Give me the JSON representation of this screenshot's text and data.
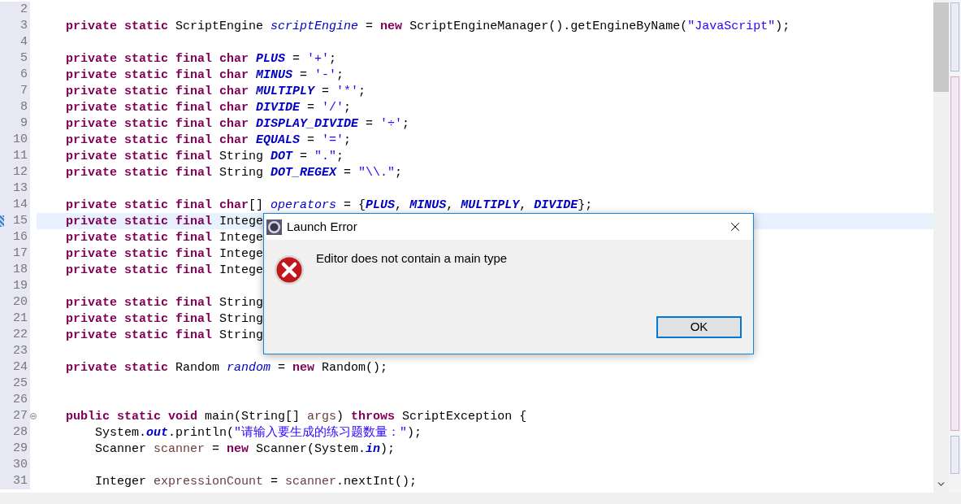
{
  "editor": {
    "lines": [
      {
        "number": "2",
        "selected": false,
        "fold": false
      },
      {
        "number": "3",
        "selected": false,
        "fold": false,
        "kind": "member",
        "tokens": [
          {
            "kind": "kw",
            "text": "private static"
          },
          {
            "kind": "plain",
            "text": " ScriptEngine "
          },
          {
            "kind": "field",
            "text": "scriptEngine"
          },
          {
            "kind": "plain",
            "text": " = "
          },
          {
            "kind": "kw",
            "text": "new"
          },
          {
            "kind": "plain",
            "text": " ScriptEngineManager().getEngineByName("
          },
          {
            "kind": "str",
            "text": "\"JavaScript\""
          },
          {
            "kind": "plain",
            "text": ");"
          }
        ]
      },
      {
        "number": "4",
        "selected": false,
        "fold": false
      },
      {
        "number": "5",
        "selected": false,
        "fold": false,
        "kind": "member",
        "tokens": [
          {
            "kind": "kw",
            "text": "private static final char"
          },
          {
            "kind": "const",
            "text": " PLUS"
          },
          {
            "kind": "plain",
            "text": " = "
          },
          {
            "kind": "str",
            "text": "'+'"
          },
          {
            "kind": "plain",
            "text": ";"
          }
        ]
      },
      {
        "number": "6",
        "selected": false,
        "fold": false,
        "kind": "member",
        "tokens": [
          {
            "kind": "kw",
            "text": "private static final char"
          },
          {
            "kind": "const",
            "text": " MINUS"
          },
          {
            "kind": "plain",
            "text": " = "
          },
          {
            "kind": "str",
            "text": "'-'"
          },
          {
            "kind": "plain",
            "text": ";"
          }
        ]
      },
      {
        "number": "7",
        "selected": false,
        "fold": false,
        "kind": "member",
        "tokens": [
          {
            "kind": "kw",
            "text": "private static final char"
          },
          {
            "kind": "const",
            "text": " MULTIPLY"
          },
          {
            "kind": "plain",
            "text": " = "
          },
          {
            "kind": "str",
            "text": "'*'"
          },
          {
            "kind": "plain",
            "text": ";"
          }
        ]
      },
      {
        "number": "8",
        "selected": false,
        "fold": false,
        "kind": "member",
        "tokens": [
          {
            "kind": "kw",
            "text": "private static final char"
          },
          {
            "kind": "const",
            "text": " DIVIDE"
          },
          {
            "kind": "plain",
            "text": " = "
          },
          {
            "kind": "str",
            "text": "'/'"
          },
          {
            "kind": "plain",
            "text": ";"
          }
        ]
      },
      {
        "number": "9",
        "selected": false,
        "fold": false,
        "kind": "member",
        "tokens": [
          {
            "kind": "kw",
            "text": "private static final char"
          },
          {
            "kind": "const",
            "text": " DISPLAY_DIVIDE"
          },
          {
            "kind": "plain",
            "text": " = "
          },
          {
            "kind": "str",
            "text": "'÷'"
          },
          {
            "kind": "plain",
            "text": ";"
          }
        ]
      },
      {
        "number": "10",
        "selected": false,
        "fold": false,
        "kind": "member",
        "tokens": [
          {
            "kind": "kw",
            "text": "private static final char"
          },
          {
            "kind": "const",
            "text": " EQUALS"
          },
          {
            "kind": "plain",
            "text": " = "
          },
          {
            "kind": "str",
            "text": "'='"
          },
          {
            "kind": "plain",
            "text": ";"
          }
        ]
      },
      {
        "number": "11",
        "selected": false,
        "fold": false,
        "kind": "member",
        "tokens": [
          {
            "kind": "kw",
            "text": "private static final"
          },
          {
            "kind": "plain",
            "text": " String "
          },
          {
            "kind": "const",
            "text": "DOT"
          },
          {
            "kind": "plain",
            "text": " = "
          },
          {
            "kind": "str",
            "text": "\".\""
          },
          {
            "kind": "plain",
            "text": ";"
          }
        ]
      },
      {
        "number": "12",
        "selected": false,
        "fold": false,
        "kind": "member",
        "tokens": [
          {
            "kind": "kw",
            "text": "private static final"
          },
          {
            "kind": "plain",
            "text": " String "
          },
          {
            "kind": "const",
            "text": "DOT_REGEX"
          },
          {
            "kind": "plain",
            "text": " = "
          },
          {
            "kind": "str",
            "text": "\"\\\\.\""
          },
          {
            "kind": "plain",
            "text": ";"
          }
        ]
      },
      {
        "number": "13",
        "selected": false,
        "fold": false
      },
      {
        "number": "14",
        "selected": false,
        "fold": false,
        "kind": "member",
        "tokens": [
          {
            "kind": "kw",
            "text": "private static final char"
          },
          {
            "kind": "plain",
            "text": "[] "
          },
          {
            "kind": "field",
            "text": "operators"
          },
          {
            "kind": "plain",
            "text": " = {"
          },
          {
            "kind": "const",
            "text": "PLUS"
          },
          {
            "kind": "plain",
            "text": ", "
          },
          {
            "kind": "const",
            "text": "MINUS"
          },
          {
            "kind": "plain",
            "text": ", "
          },
          {
            "kind": "const",
            "text": "MULTIPLY"
          },
          {
            "kind": "plain",
            "text": ", "
          },
          {
            "kind": "const",
            "text": "DIVIDE"
          },
          {
            "kind": "plain",
            "text": "};"
          }
        ]
      },
      {
        "number": "15",
        "selected": true,
        "fold": false,
        "kind": "member",
        "tokens": [
          {
            "kind": "kw",
            "text": "private static final"
          },
          {
            "kind": "plain",
            "text": " Intege"
          }
        ]
      },
      {
        "number": "16",
        "selected": false,
        "fold": false,
        "kind": "member",
        "tokens": [
          {
            "kind": "kw",
            "text": "private static final"
          },
          {
            "kind": "plain",
            "text": " Intege"
          }
        ]
      },
      {
        "number": "17",
        "selected": false,
        "fold": false,
        "kind": "member",
        "tokens": [
          {
            "kind": "kw",
            "text": "private static final"
          },
          {
            "kind": "plain",
            "text": " Intege"
          }
        ]
      },
      {
        "number": "18",
        "selected": false,
        "fold": false,
        "kind": "member",
        "tokens": [
          {
            "kind": "kw",
            "text": "private static final"
          },
          {
            "kind": "plain",
            "text": " Intege"
          }
        ]
      },
      {
        "number": "19",
        "selected": false,
        "fold": false
      },
      {
        "number": "20",
        "selected": false,
        "fold": false,
        "kind": "member",
        "tokens": [
          {
            "kind": "kw",
            "text": "private static final"
          },
          {
            "kind": "plain",
            "text": " String"
          }
        ]
      },
      {
        "number": "21",
        "selected": false,
        "fold": false,
        "kind": "member",
        "tokens": [
          {
            "kind": "kw",
            "text": "private static final"
          },
          {
            "kind": "plain",
            "text": " String"
          }
        ]
      },
      {
        "number": "22",
        "selected": false,
        "fold": false,
        "kind": "member",
        "tokens": [
          {
            "kind": "kw",
            "text": "private static final"
          },
          {
            "kind": "plain",
            "text": " String"
          }
        ]
      },
      {
        "number": "23",
        "selected": false,
        "fold": false
      },
      {
        "number": "24",
        "selected": false,
        "fold": false,
        "kind": "member",
        "tokens": [
          {
            "kind": "kw",
            "text": "private static"
          },
          {
            "kind": "plain",
            "text": " Random "
          },
          {
            "kind": "field",
            "text": "random"
          },
          {
            "kind": "plain",
            "text": " = "
          },
          {
            "kind": "kw",
            "text": "new"
          },
          {
            "kind": "plain",
            "text": " Random();"
          }
        ]
      },
      {
        "number": "25",
        "selected": false,
        "fold": false
      },
      {
        "number": "26",
        "selected": false,
        "fold": false
      },
      {
        "number": "27",
        "selected": false,
        "fold": true,
        "kind": "member",
        "tokens": [
          {
            "kind": "kw",
            "text": "public static void"
          },
          {
            "kind": "plain",
            "text": " main(String[] "
          },
          {
            "kind": "local",
            "text": "args"
          },
          {
            "kind": "plain",
            "text": ") "
          },
          {
            "kind": "kw",
            "text": "throws"
          },
          {
            "kind": "plain",
            "text": " ScriptException {"
          }
        ]
      },
      {
        "number": "28",
        "selected": false,
        "fold": false,
        "kind": "statement",
        "tokens": [
          {
            "kind": "plain",
            "text": "System."
          },
          {
            "kind": "const",
            "text": "out"
          },
          {
            "kind": "plain",
            "text": ".println("
          },
          {
            "kind": "str",
            "text": "\"请输入要生成的练习题数量：\""
          },
          {
            "kind": "plain",
            "text": ");"
          }
        ]
      },
      {
        "number": "29",
        "selected": false,
        "fold": false,
        "kind": "statement",
        "tokens": [
          {
            "kind": "plain",
            "text": "Scanner "
          },
          {
            "kind": "local",
            "text": "scanner"
          },
          {
            "kind": "plain",
            "text": " = "
          },
          {
            "kind": "kw",
            "text": "new"
          },
          {
            "kind": "plain",
            "text": " Scanner(System."
          },
          {
            "kind": "const",
            "text": "in"
          },
          {
            "kind": "plain",
            "text": ");"
          }
        ]
      },
      {
        "number": "30",
        "selected": false,
        "fold": false
      },
      {
        "number": "31",
        "selected": false,
        "fold": false,
        "kind": "statement",
        "tokens": [
          {
            "kind": "plain",
            "text": "Integer "
          },
          {
            "kind": "local",
            "text": "expressionCount"
          },
          {
            "kind": "plain",
            "text": " = "
          },
          {
            "kind": "local",
            "text": "scanner"
          },
          {
            "kind": "plain",
            "text": ".nextInt();"
          }
        ]
      }
    ]
  },
  "dialog": {
    "title": "Launch Error",
    "message": "Editor does not contain a main type",
    "buttons": [
      "OK"
    ]
  }
}
